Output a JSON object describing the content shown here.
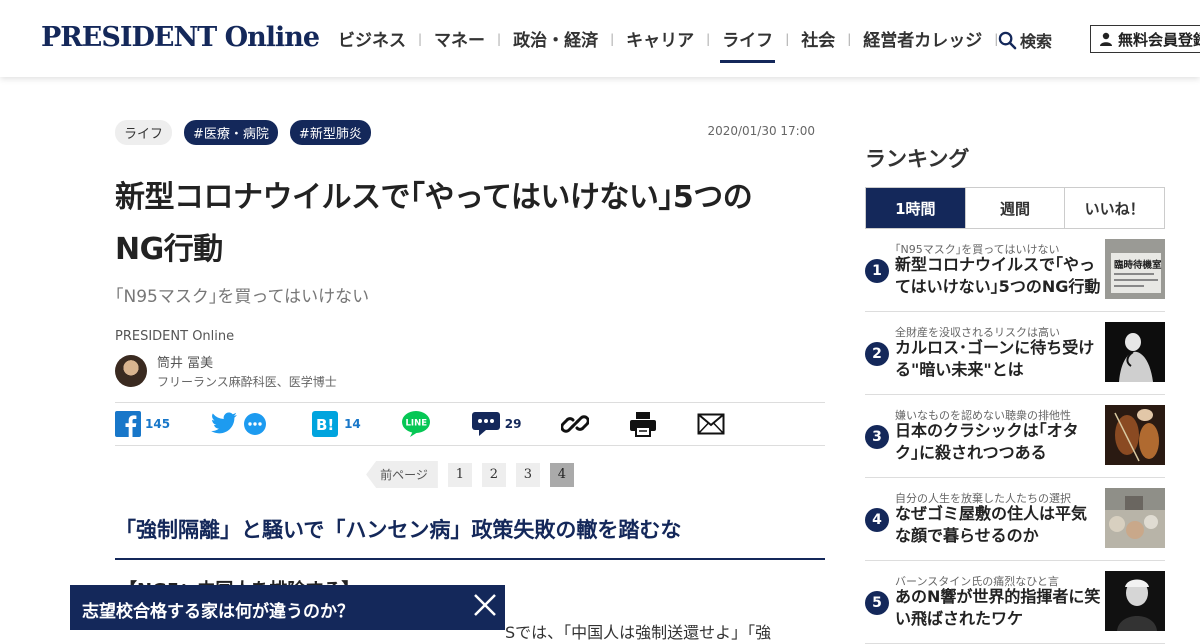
{
  "header": {
    "logo": "PRESIDENT Online",
    "nav": [
      {
        "label": "ビジネス"
      },
      {
        "label": "マネー"
      },
      {
        "label": "政治・経済"
      },
      {
        "label": "キャリア"
      },
      {
        "label": "ライフ",
        "active": true
      },
      {
        "label": "社会"
      },
      {
        "label": "経営者カレッジ"
      }
    ],
    "nav_separator": "|",
    "search_label": "検索",
    "signup_label": "無料会員登録"
  },
  "article": {
    "tags": [
      "ライフ",
      "#医療・病院",
      "#新型肺炎"
    ],
    "date": "2020/01/30 17:00",
    "title_line1": "新型コロナウイルスで｢やってはいけない｣5つの",
    "title_line2": "NG行動",
    "subtitle": "｢N95マスク｣を買ってはいけない",
    "source": "PRESIDENT Online",
    "author_name": "筒井 冨美",
    "author_title": "フリーランス麻酔科医、医学博士",
    "share": {
      "facebook_count": "145",
      "hatena_count": "14",
      "comment_count": "29"
    },
    "pager": {
      "prev": "前ページ",
      "pages": [
        "1",
        "2",
        "3",
        "4"
      ],
      "current": "4"
    },
    "section_heading": "「強制隔離」と騒いで「ハンセン病」政策失敗の轍を踏むな",
    "ng_heading": "【NG5：中国人を排除する】",
    "body_fragment": "Sでは、「中国人は強制送還せよ」「強"
  },
  "banner": {
    "text": "志望校合格する家は何が違うのか？"
  },
  "ranking": {
    "title": "ランキング",
    "tabs": [
      "1時間",
      "週間",
      "いいね！"
    ],
    "active_tab": "1時間",
    "items": [
      {
        "rank": "1",
        "sub": "｢N95マスク｣を買ってはいけない",
        "headline": "新型コロナウイルスで｢やってはいけない｣5つのNG行動",
        "thumb_text": "臨時待機室"
      },
      {
        "rank": "2",
        "sub": "全財産を没収されるリスクは高い",
        "headline": "カルロス･ゴーンに待ち受ける\"暗い未来\"とは"
      },
      {
        "rank": "3",
        "sub": "嫌いなものを認めない聴衆の排他性",
        "headline": "日本のクラシックは｢オタク｣に殺されつつある"
      },
      {
        "rank": "4",
        "sub": "自分の人生を放棄した人たちの選択",
        "headline": "なぜゴミ屋敷の住人は平気な顔で暮らせるのか"
      },
      {
        "rank": "5",
        "sub": "バーンスタイン氏の痛烈なひと言",
        "headline": "あのN響が世界的指揮者に笑い飛ばされたワケ"
      }
    ]
  },
  "colors": {
    "brand_navy": "#14285a",
    "link_blue": "#1877c9"
  }
}
